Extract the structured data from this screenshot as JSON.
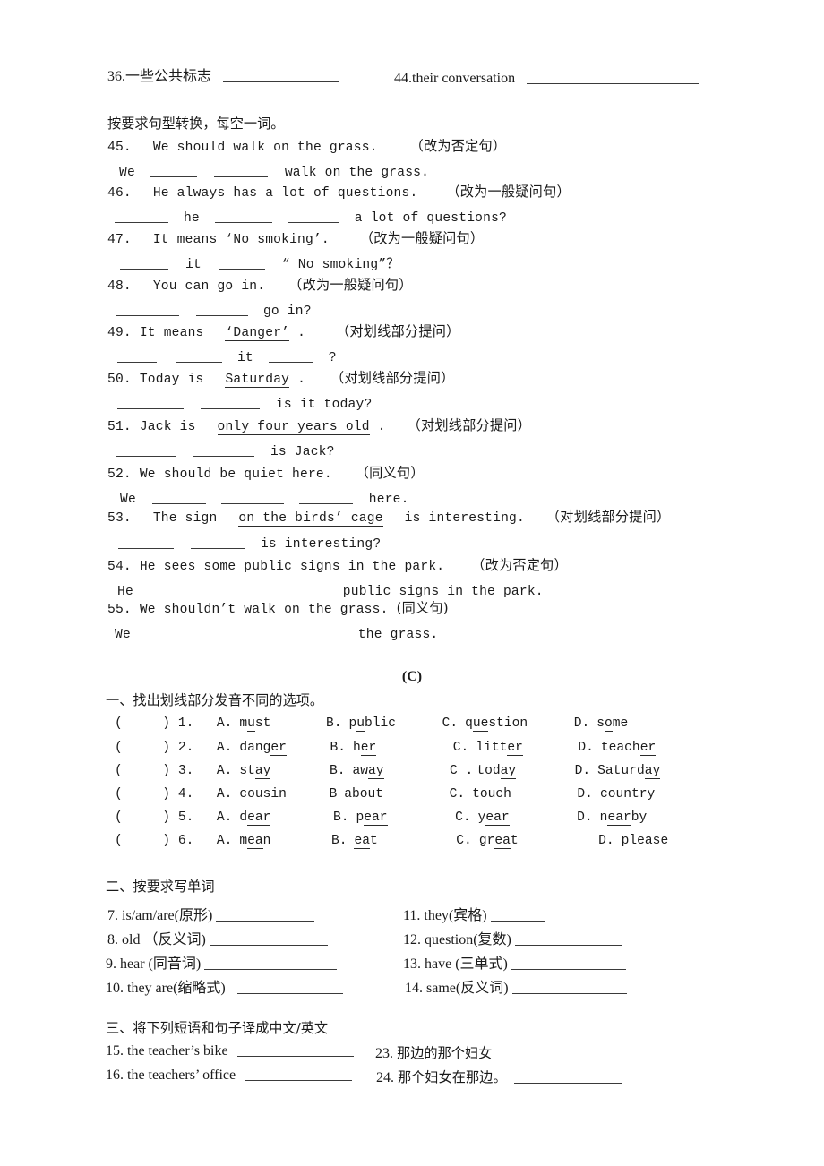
{
  "top_row": {
    "left_label": "36.一些公共标志",
    "right_label": "44.their conversation"
  },
  "transform_section": {
    "instruction": "按要求句型转换，每空一词。",
    "items": [
      {
        "num": "45.",
        "prompt_before": "We should walk on the grass.",
        "tag": "（改为否定句）",
        "answer_prefix": "We",
        "answer_suffix": "walk on the grass."
      },
      {
        "num": "46.",
        "prompt_before": "He always has a lot of questions.",
        "tag": "（改为一般疑问句）",
        "answer_mid": "he",
        "answer_suffix": "a lot of questions?"
      },
      {
        "num": "47.",
        "prompt_before": "It means ‘No smoking’.",
        "tag": "（改为一般疑问句）",
        "answer_mid": "it",
        "answer_suffix": "“ No smoking”？"
      },
      {
        "num": "48.",
        "prompt_before": "You can go in.",
        "tag": "（改为一般疑问句）",
        "answer_suffix": "go in?"
      },
      {
        "num": "49.",
        "prompt_before": "It means",
        "prompt_underlined": "‘Danger’",
        "prompt_after": ".",
        "tag": "（对划线部分提问）",
        "answer_mid": "it",
        "answer_suffix": "?"
      },
      {
        "num": "50.",
        "prompt_before": "Today is",
        "prompt_underlined": "Saturday",
        "prompt_after": ".",
        "tag": "（对划线部分提问）",
        "answer_suffix": "is it today?"
      },
      {
        "num": "51.",
        "prompt_before": "Jack is",
        "prompt_underlined": "only four years old",
        "prompt_after": ".",
        "tag": "（对划线部分提问）",
        "answer_suffix": "is Jack?"
      },
      {
        "num": "52.",
        "prompt_before": "We should be quiet here.",
        "tag": "（同义句）",
        "answer_prefix": "We",
        "answer_suffix": "here."
      },
      {
        "num": "53.",
        "prompt_before": "The sign",
        "prompt_underlined": "on the birds’  cage",
        "prompt_after": "is interesting.",
        "tag": "（对划线部分提问）",
        "answer_suffix": "is interesting?"
      },
      {
        "num": "54.",
        "prompt_before": "He sees some public signs in the park.",
        "tag": "（改为否定句）",
        "answer_prefix": "He",
        "answer_suffix": "public signs in the park."
      },
      {
        "num": "55.",
        "prompt_before": "We shouldn’t walk on the grass.",
        "tag": "(同义句)",
        "answer_prefix": "We",
        "answer_suffix": "the grass."
      }
    ]
  },
  "part_c": {
    "heading": "(C)",
    "section_one": {
      "title": "一、找出划线部分发音不同的选项。",
      "paren_open": "(",
      "paren_close": ")",
      "questions": [
        {
          "num": "1.",
          "options": [
            {
              "letter": "A.",
              "pre": "m",
              "mid": "u",
              "post": "st"
            },
            {
              "letter": "B.",
              "pre": "p",
              "mid": "u",
              "post": "blic"
            },
            {
              "letter": "C.",
              "pre": "q",
              "mid": "ue",
              "post": "stion"
            },
            {
              "letter": "D.",
              "pre": "s",
              "mid": "o",
              "post": "me"
            }
          ]
        },
        {
          "num": "2.",
          "options": [
            {
              "letter": "A.",
              "pre": "dang",
              "mid": "er",
              "post": ""
            },
            {
              "letter": "B.",
              "pre": "h",
              "mid": "er",
              "post": ""
            },
            {
              "letter": "C.",
              "pre": "litt",
              "mid": "er",
              "post": ""
            },
            {
              "letter": "D.",
              "pre": "teach",
              "mid": "er",
              "post": ""
            }
          ]
        },
        {
          "num": "3.",
          "options": [
            {
              "letter": "A.",
              "pre": "st",
              "mid": "ay",
              "post": ""
            },
            {
              "letter": "B.",
              "pre": "aw",
              "mid": "ay",
              "post": ""
            },
            {
              "letter": "C .",
              "pre": "tod",
              "mid": "ay",
              "post": ""
            },
            {
              "letter": "D.",
              "pre": "Saturd",
              "mid": "ay",
              "post": ""
            }
          ]
        },
        {
          "num": "4.",
          "options": [
            {
              "letter": "A.",
              "pre": "c",
              "mid": "ou",
              "post": "sin"
            },
            {
              "letter": "B",
              "pre": "ab",
              "mid": "ou",
              "post": "t"
            },
            {
              "letter": "C.",
              "pre": "t",
              "mid": "ou",
              "post": "ch"
            },
            {
              "letter": "D.",
              "pre": "c",
              "mid": "ou",
              "post": "ntry"
            }
          ]
        },
        {
          "num": "5.",
          "options": [
            {
              "letter": "A.",
              "pre": "d",
              "mid": "ear",
              "post": ""
            },
            {
              "letter": "B.",
              "pre": "p",
              "mid": "ear",
              "post": ""
            },
            {
              "letter": "C.",
              "pre": "y",
              "mid": "ear",
              "post": ""
            },
            {
              "letter": "D.",
              "pre": "n",
              "mid": "ear",
              "post": "by"
            }
          ]
        },
        {
          "num": "6.",
          "options": [
            {
              "letter": "A.",
              "pre": "m",
              "mid": "ea",
              "post": "n"
            },
            {
              "letter": "B.",
              "pre": "",
              "mid": "ea",
              "post": "t"
            },
            {
              "letter": "C.",
              "pre": "gr",
              "mid": "ea",
              "post": "t"
            },
            {
              "letter": "D.",
              "pre": "please",
              "mid": "",
              "post": ""
            }
          ]
        }
      ]
    },
    "section_two": {
      "title": "二、按要求写单词",
      "left_items": [
        {
          "num": "7.",
          "text": "is/am/are(原形)"
        },
        {
          "num": "8.",
          "text": "old （反义词)"
        },
        {
          "num": "9.",
          "text": "hear (同音词)"
        },
        {
          "num": "10.",
          "text": "they are(缩略式)"
        }
      ],
      "right_items": [
        {
          "num": "11.",
          "text": "they(宾格)"
        },
        {
          "num": "12.",
          "text": "question(复数)"
        },
        {
          "num": "13.",
          "text": "have (三单式)"
        },
        {
          "num": "14.",
          "text": "same(反义词)"
        }
      ]
    },
    "section_three": {
      "title": "三、将下列短语和句子译成中文/英文",
      "left_items": [
        {
          "num": "15.",
          "text": "the teacher’s bike"
        },
        {
          "num": "16.",
          "text": "the teachers’ office"
        }
      ],
      "right_items": [
        {
          "num": "23.",
          "text": "那边的那个妇女"
        },
        {
          "num": "24.",
          "text": "那个妇女在那边。"
        }
      ]
    }
  }
}
